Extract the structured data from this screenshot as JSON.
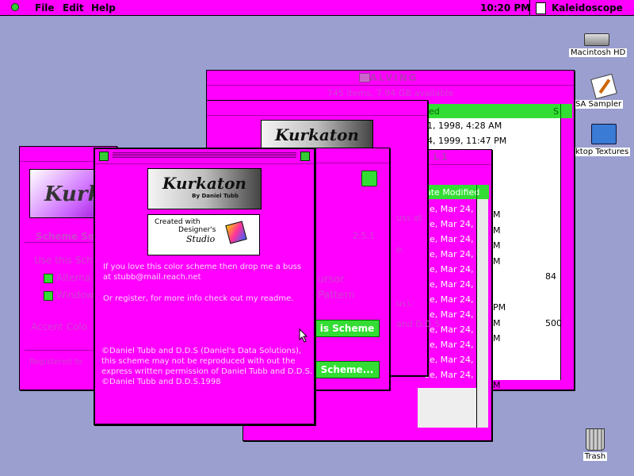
{
  "menubar": {
    "items": [
      "File",
      "Edit",
      "Help"
    ],
    "clock": "10:20 PM",
    "app_name": "Kaleidoscope"
  },
  "desktop": {
    "icons": [
      {
        "label": "Macintosh HD"
      },
      {
        "label": "SA Sampler"
      },
      {
        "label": "ktop Textures"
      },
      {
        "label": "Trash"
      }
    ]
  },
  "finder_window": {
    "title": "TALVING",
    "info": "745 items, 7.94 GB available",
    "column_date": "ed",
    "column_size": "S",
    "rows": [
      "1, 1998, 4:28 AM",
      "4, 1999, 11:47 PM"
    ]
  },
  "list_window": {
    "title_fragment": "L1",
    "column_header": "ate Modified",
    "rows": [
      "ue, Mar 24,",
      "ue, Mar 24,",
      "ue, Mar 24,",
      "ue, Mar 24,",
      "ue, Mar 24,",
      "ue, Mar 24,",
      "ue, Mar 24,",
      "ue, Mar 24,",
      "ue, Mar 24,",
      "ue, Mar 24,",
      "ue, Mar 24,",
      "ue, Mar 24,"
    ],
    "right_col": [
      "M",
      "M",
      "M",
      "M",
      "",
      "",
      "PM",
      "M",
      "M",
      "",
      "",
      "M"
    ],
    "size_col": [
      "",
      "",
      "",
      "",
      "84",
      "",
      "",
      "500",
      "",
      "",
      "",
      ""
    ]
  },
  "mid_window": {
    "logo": "Kurkaton",
    "text_fragments": [
      "uss at",
      "e.",
      "us),",
      "and D.D.S."
    ],
    "version": "2.5.1",
    "cursor_label": "ursor",
    "pattern_label": "Pattern",
    "button1": "is Scheme",
    "button2": "Scheme..."
  },
  "left_window": {
    "logo": "Kurk",
    "tab": "Scheme Se",
    "group": "Use this Sch",
    "check1": "Alterna",
    "check2": "Window",
    "accent": "Accent Colo",
    "registered": "Registered to"
  },
  "about_window": {
    "logo": "Kurkaton",
    "logo_sub": "By Daniel Tubb",
    "created_line1": "Created with",
    "created_line2": "Designer's",
    "created_line3": "Studio",
    "para1": "If you love this color scheme then drop me a buss at stubb@mail.reach.net",
    "para2": "Or register, for more info check out my readme.",
    "copyright": "©Daniel Tubb and D.D.S (Daniel's Data Solutions), this scheme may not be reproduced with out the express written permission of Daniel Tubb and D.D.S. ©Daniel Tubb and D.D.S.1998"
  }
}
